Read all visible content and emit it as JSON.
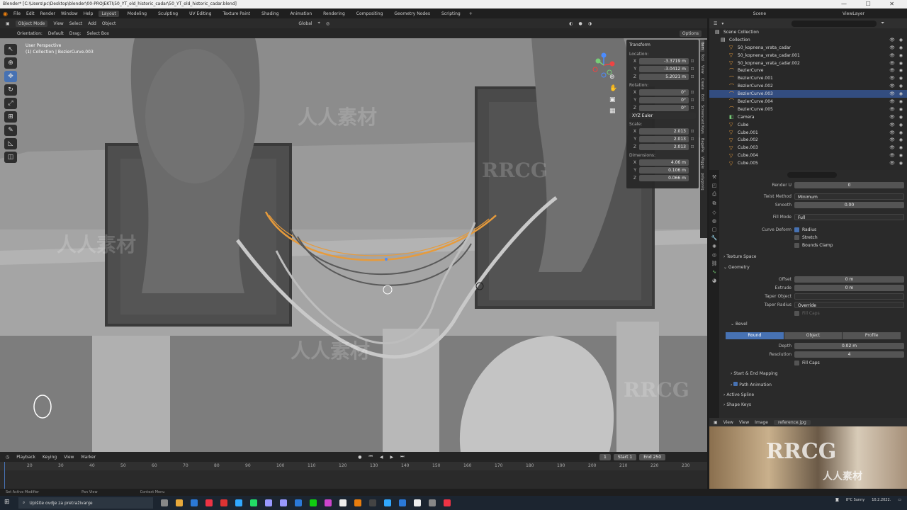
{
  "window": {
    "title": "Blender* [C:\\Users\\pc\\Desktop\\blender\\00-PROJEKTI\\50_YT_old_historic_cadar\\50_YT_old_historic_cadar.blend]"
  },
  "menu": [
    "File",
    "Edit",
    "Render",
    "Window",
    "Help"
  ],
  "workspaces": [
    "Layout",
    "Modeling",
    "Sculpting",
    "UV Editing",
    "Texture Paint",
    "Shading",
    "Animation",
    "Rendering",
    "Compositing",
    "Geometry Nodes",
    "Scripting"
  ],
  "active_workspace": "Layout",
  "scene": {
    "name": "Scene",
    "view_layer": "ViewLayer"
  },
  "viewport_header": {
    "mode": "Object Mode",
    "menus": [
      "View",
      "Select",
      "Add",
      "Object"
    ],
    "transform": "Global",
    "options": "Options"
  },
  "tool_settings": {
    "orientation_label": "Orientation:",
    "orientation": "Default",
    "drag_label": "Drag:",
    "drag": "Select Box"
  },
  "viewport_info": {
    "line1": "User Perspective",
    "line2": "(1) Collection | BezierCurve.003"
  },
  "npanel": {
    "title": "Transform",
    "location_label": "Location:",
    "location": [
      {
        "axis": "X",
        "value": "-3.3719 m"
      },
      {
        "axis": "Y",
        "value": "-3.0412 m"
      },
      {
        "axis": "Z",
        "value": "5.2021 m"
      }
    ],
    "rotation_label": "Rotation:",
    "rotation": [
      {
        "axis": "X",
        "value": "0°"
      },
      {
        "axis": "Y",
        "value": "0°"
      },
      {
        "axis": "Z",
        "value": "0°"
      }
    ],
    "rotation_mode": "XYZ Euler",
    "scale_label": "Scale:",
    "scale": [
      {
        "axis": "X",
        "value": "2.013"
      },
      {
        "axis": "Y",
        "value": "2.013"
      },
      {
        "axis": "Z",
        "value": "2.013"
      }
    ],
    "dimensions_label": "Dimensions:",
    "dimensions": [
      {
        "axis": "X",
        "value": "4.06 m"
      },
      {
        "axis": "Y",
        "value": "0.106 m"
      },
      {
        "axis": "Z",
        "value": "0.066 m"
      }
    ],
    "tabs": [
      "Item",
      "Tool",
      "View",
      "Create",
      "Edit",
      "Screencast Keys",
      "BagaPie",
      "Wiggle",
      "polygoniq"
    ]
  },
  "outliner": {
    "search_placeholder": "",
    "root": "Scene Collection",
    "items": [
      {
        "name": "Collection",
        "type": "collection",
        "selected": false
      },
      {
        "name": "50_kopnena_vrata_cadar",
        "type": "object",
        "selected": false
      },
      {
        "name": "50_kopnena_vrata_cadar.001",
        "type": "object",
        "selected": false
      },
      {
        "name": "50_kopnena_vrata_cadar.002",
        "type": "object",
        "selected": false
      },
      {
        "name": "BezierCurve",
        "type": "curve",
        "selected": false
      },
      {
        "name": "BezierCurve.001",
        "type": "curve",
        "selected": false
      },
      {
        "name": "BezierCurve.002",
        "type": "curve",
        "selected": false
      },
      {
        "name": "BezierCurve.003",
        "type": "curve",
        "selected": true
      },
      {
        "name": "BezierCurve.004",
        "type": "curve",
        "selected": false
      },
      {
        "name": "BezierCurve.005",
        "type": "curve",
        "selected": false
      },
      {
        "name": "Camera",
        "type": "camera",
        "selected": false
      },
      {
        "name": "Cube",
        "type": "object",
        "selected": false
      },
      {
        "name": "Cube.001",
        "type": "object",
        "selected": false
      },
      {
        "name": "Cube.002",
        "type": "object",
        "selected": false
      },
      {
        "name": "Cube.003",
        "type": "object",
        "selected": false
      },
      {
        "name": "Cube.004",
        "type": "object",
        "selected": false
      },
      {
        "name": "Cube.005",
        "type": "object",
        "selected": false
      }
    ]
  },
  "properties": {
    "render_u_label": "Render U",
    "render_u": "0",
    "twist_method_label": "Twist Method",
    "twist_method": "Minimum",
    "smooth_label": "Smooth",
    "smooth": "0.00",
    "fill_mode_label": "Fill Mode",
    "fill_mode": "Full",
    "curve_deform_label": "Curve Deform",
    "radius_label": "Radius",
    "stretch_label": "Stretch",
    "bounds_clamp_label": "Bounds Clamp",
    "texture_space": "Texture Space",
    "geometry": "Geometry",
    "offset_label": "Offset",
    "offset": "0 m",
    "extrude_label": "Extrude",
    "extrude": "0 m",
    "taper_object_label": "Taper Object",
    "taper_radius_label": "Taper Radius",
    "taper_radius": "Override",
    "fill_caps_disabled": "Fill Caps",
    "bevel": "Bevel",
    "bevel_tabs": [
      "Round",
      "Object",
      "Profile"
    ],
    "depth_label": "Depth",
    "depth": "0.02 m",
    "resolution_label": "Resolution",
    "resolution": "4",
    "fill_caps_label": "Fill Caps",
    "start_end": "Start & End Mapping",
    "path_animation": "Path Animation",
    "active_spline": "Active Spline",
    "shape_keys": "Shape Keys"
  },
  "image_editor": {
    "menus": [
      "View",
      "View",
      "Image"
    ],
    "image_name": "reference.jpg"
  },
  "timeline": {
    "menus": [
      "Playback",
      "Keying",
      "View",
      "Marker"
    ],
    "frame": "1",
    "start_label": "Start",
    "start": "1",
    "end_label": "End",
    "end": "250",
    "ruler": [
      "20",
      "30",
      "40",
      "50",
      "60",
      "70",
      "80",
      "90",
      "100",
      "110",
      "120",
      "130",
      "140",
      "150",
      "160",
      "170",
      "180",
      "190",
      "200",
      "210",
      "220",
      "230"
    ]
  },
  "statusbar": [
    "Set Active Modifier",
    "Pan View",
    "Context Menu"
  ],
  "taskbar": {
    "search_placeholder": "Upišite ovdje za pretraživanje",
    "weather": "8°C Sunny",
    "date": "10.2.2022."
  },
  "watermarks": [
    "RRCG",
    "人人素材"
  ],
  "colors": {
    "accent": "#4772b3",
    "selected_curve": "#e79b3b",
    "viewport_bg": "#8a8a8a"
  }
}
